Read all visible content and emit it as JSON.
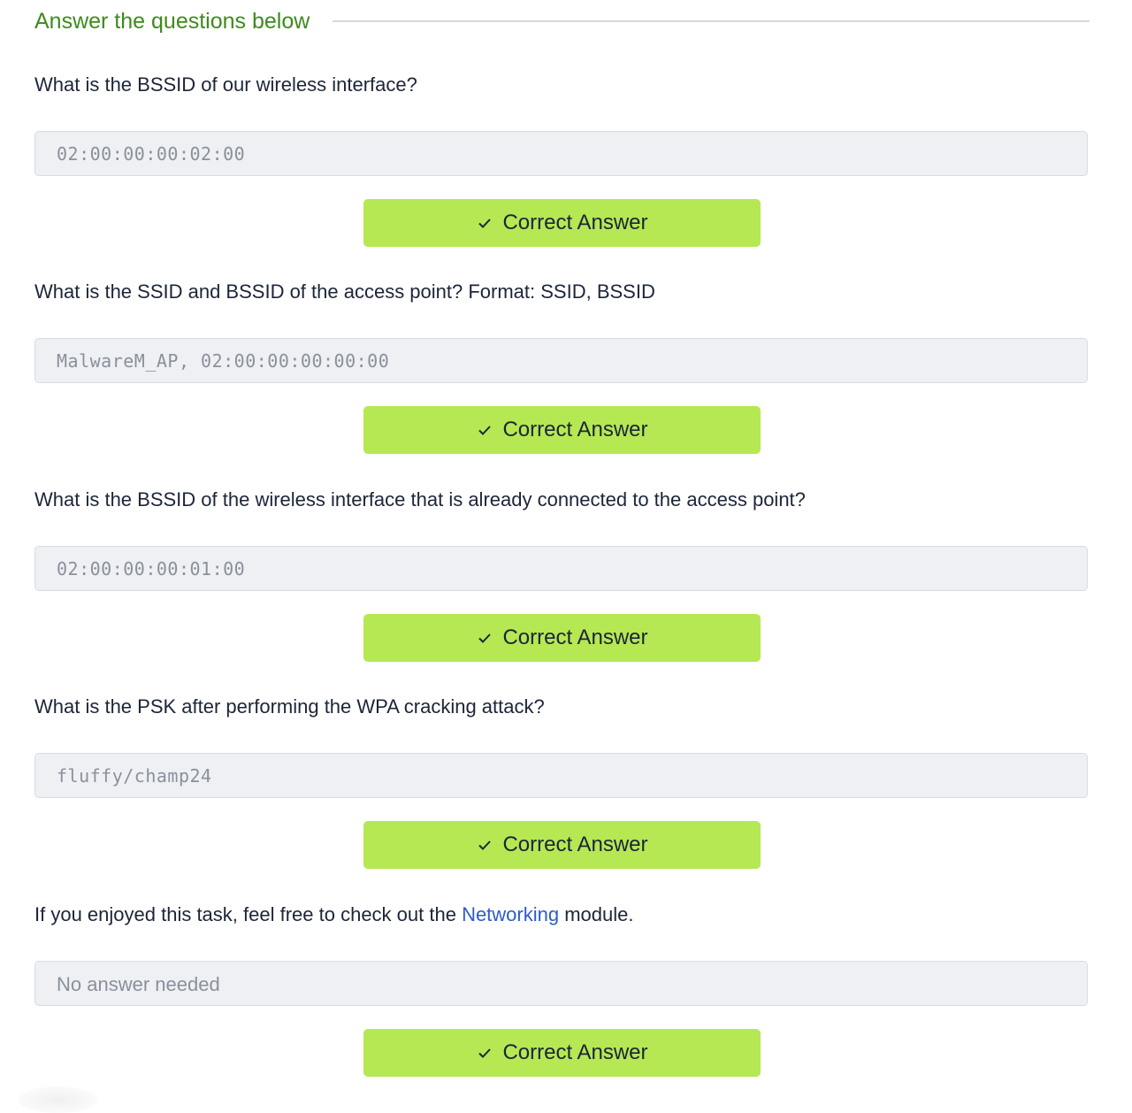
{
  "section": {
    "title": "Answer the questions below"
  },
  "questions": [
    {
      "text": "What is the BSSID of our wireless interface?",
      "answer": "02:00:00:00:02:00",
      "button_label": "Correct Answer"
    },
    {
      "text": "What is the SSID and BSSID of the access point? Format: SSID, BSSID",
      "answer": "MalwareM_AP, 02:00:00:00:00:00",
      "button_label": "Correct Answer"
    },
    {
      "text": "What is the BSSID of the wireless interface that is already connected to the access point?",
      "answer": "02:00:00:00:01:00",
      "button_label": "Correct Answer"
    },
    {
      "text": "What is the PSK after performing the WPA cracking attack?",
      "answer": "fluffy/champ24",
      "button_label": "Correct Answer"
    },
    {
      "text_before": "If you enjoyed this task, feel free to check out the ",
      "link_text": "Networking",
      "text_after": " module.",
      "answer": "No answer needed",
      "button_label": "Correct Answer"
    }
  ],
  "icons": {
    "check": "check-icon"
  },
  "colors": {
    "section_title": "#3f8a1e",
    "button_bg": "#b5e853",
    "link": "#2c5cc9",
    "field_bg": "#eef0f4"
  }
}
